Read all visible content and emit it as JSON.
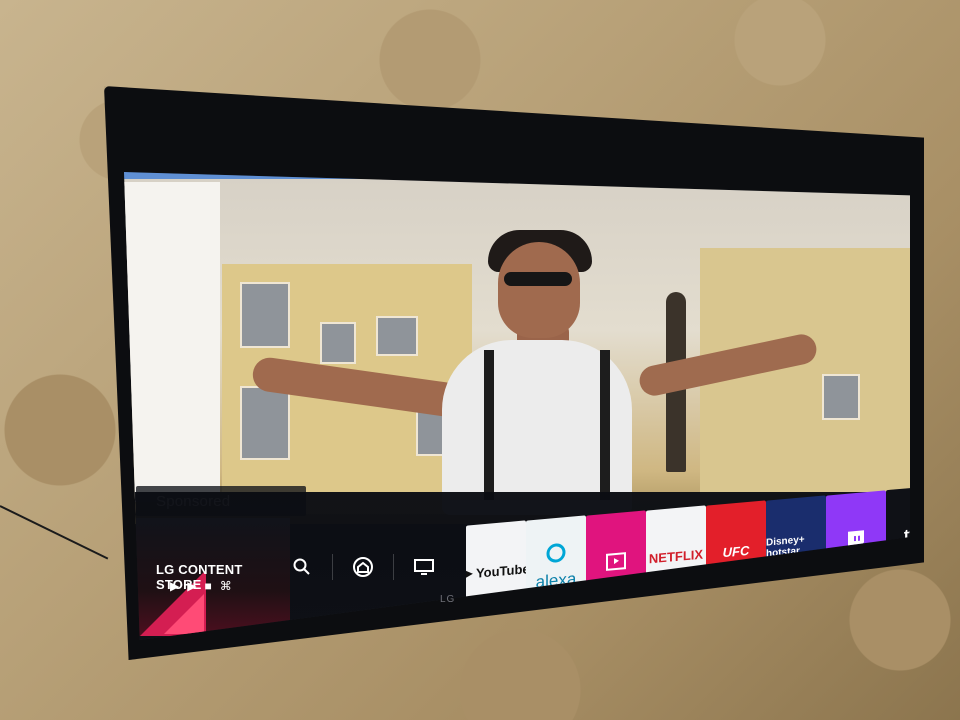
{
  "overlay": {
    "sponsored_label": "Sponsored"
  },
  "launcher": {
    "content_store_label": "LG CONTENT STORE",
    "apps": [
      {
        "name": "YouTube",
        "icon": "youtube-icon",
        "color": "#ff0000"
      },
      {
        "name": "alexa",
        "icon": "alexa-icon",
        "color": "#00a6d6"
      },
      {
        "name": "",
        "icon": "store-icon",
        "color": "#e0147e"
      },
      {
        "name": "NETFLIX",
        "icon": "netflix-icon",
        "color": "#d11f2b"
      },
      {
        "name": "UFC",
        "icon": "ufc-icon",
        "color": "#e31f2a"
      },
      {
        "name": "Disney+ hotstar",
        "icon": "hotstar-icon",
        "color": "#1a2d6d"
      },
      {
        "name": "",
        "icon": "twitch-icon",
        "color": "#8f38f7"
      },
      {
        "name": "tv",
        "icon": "apple-tv-icon",
        "color": "#111111"
      }
    ],
    "controls": [
      {
        "icon": "search-icon"
      },
      {
        "icon": "home-icon"
      },
      {
        "icon": "tv-input-icon"
      },
      {
        "icon": "recent-icon"
      }
    ]
  },
  "tv_brand_mark": "LG"
}
